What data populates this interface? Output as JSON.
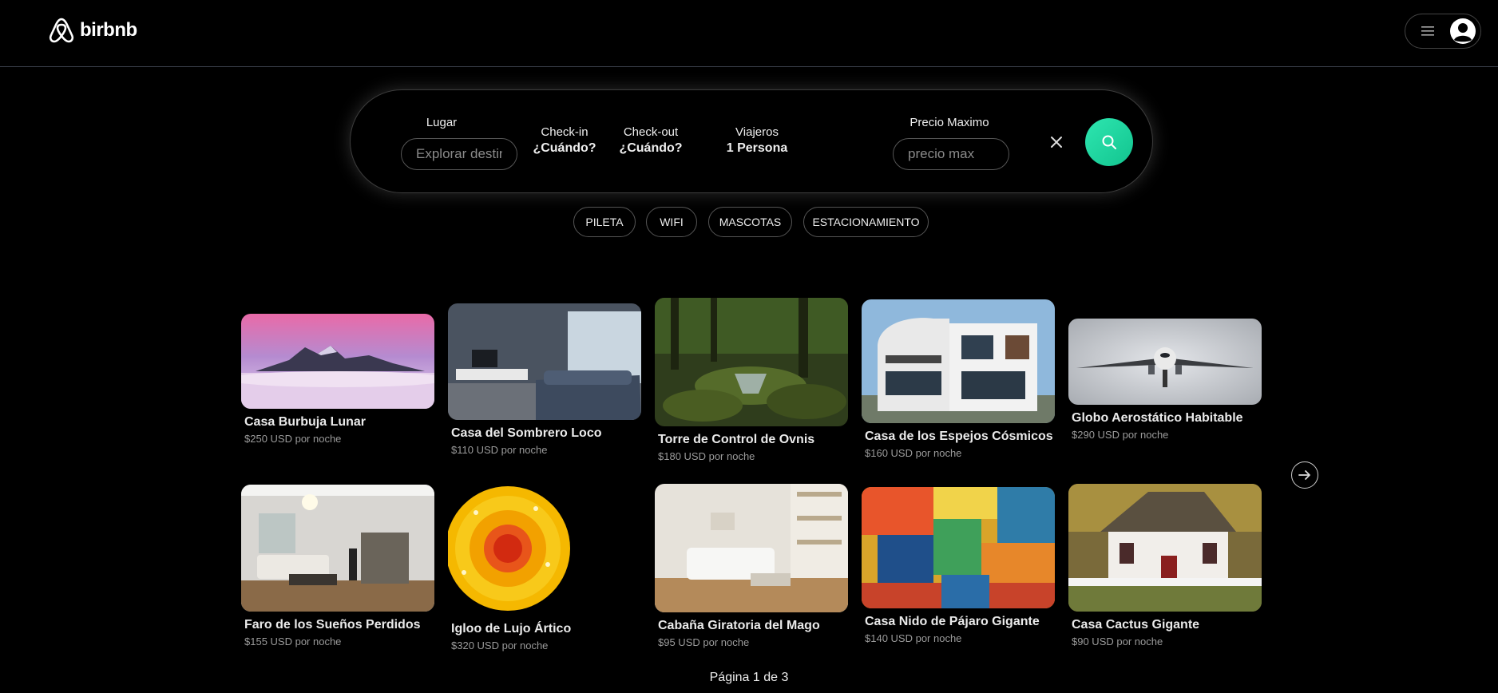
{
  "brand": {
    "name": "birbnb"
  },
  "search": {
    "place_label": "Lugar",
    "place_placeholder": "Explorar destinos",
    "checkin_label": "Check-in",
    "checkin_value": "¿Cuándo?",
    "checkout_label": "Check-out",
    "checkout_value": "¿Cuándo?",
    "travelers_label": "Viajeros",
    "travelers_value": "1 Persona",
    "price_label": "Precio Maximo",
    "price_placeholder": "precio max"
  },
  "filters": [
    "PILETA",
    "WIFI",
    "MASCOTAS",
    "ESTACIONAMIENTO"
  ],
  "listings": [
    {
      "title": "Casa Burbuja Lunar",
      "price": "$250 USD por noche"
    },
    {
      "title": "Casa del Sombrero Loco",
      "price": "$110 USD por noche"
    },
    {
      "title": "Torre de Control de Ovnis",
      "price": "$180 USD por noche"
    },
    {
      "title": "Casa de los Espejos Cósmicos",
      "price": "$160 USD por noche"
    },
    {
      "title": "Globo Aerostático Habitable",
      "price": "$290 USD por noche"
    },
    {
      "title": "Faro de los Sueños Perdidos",
      "price": "$155 USD por noche"
    },
    {
      "title": "Igloo de Lujo Ártico",
      "price": "$320 USD por noche"
    },
    {
      "title": "Cabaña Giratoria del Mago",
      "price": "$95 USD por noche"
    },
    {
      "title": "Casa Nido de Pájaro Gigante",
      "price": "$140 USD por noche"
    },
    {
      "title": "Casa Cactus Gigante",
      "price": "$90 USD por noche"
    }
  ],
  "pagination": {
    "text": "Página 1 de 3"
  },
  "colors": {
    "accent": "#1fd8a0",
    "background": "#000000"
  },
  "icons": {
    "logo": "airbnb-logo-icon",
    "menu": "hamburger-icon",
    "user": "user-avatar-icon",
    "clear": "close-icon",
    "search": "search-icon",
    "next": "arrow-right-icon"
  }
}
